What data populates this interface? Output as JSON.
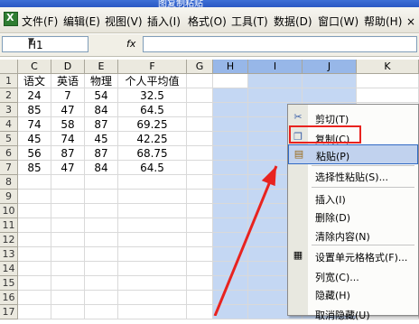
{
  "window": {
    "title_fragment": "图复制粘贴"
  },
  "menubar": {
    "items": [
      "文件(F)",
      "编辑(E)",
      "视图(V)",
      "插入(I)",
      "格式(O)",
      "工具(T)",
      "数据(D)",
      "窗口(W)",
      "帮助(H)"
    ],
    "close_glyph": "×",
    "restore_glyph": "▫"
  },
  "formula_bar": {
    "cell_ref": "H1",
    "fx_label": "fx",
    "content": ""
  },
  "columns": [
    "C",
    "D",
    "E",
    "F",
    "G",
    "H",
    "I",
    "J",
    "K"
  ],
  "rows": [
    "1",
    "2",
    "3",
    "4",
    "5",
    "6",
    "7",
    "8",
    "9",
    "10",
    "11",
    "12",
    "13",
    "14",
    "15",
    "16",
    "17"
  ],
  "table": {
    "headers": [
      "语文",
      "英语",
      "物理",
      "个人平均值"
    ],
    "data": [
      [
        "24",
        "7",
        "54",
        "32.5"
      ],
      [
        "85",
        "47",
        "84",
        "64.5"
      ],
      [
        "74",
        "58",
        "87",
        "69.25"
      ],
      [
        "45",
        "74",
        "45",
        "42.25"
      ],
      [
        "56",
        "87",
        "87",
        "68.75"
      ],
      [
        "85",
        "47",
        "84",
        "64.5"
      ]
    ]
  },
  "context_menu": {
    "items": [
      {
        "label": "剪切(T)",
        "icon": "scissors-icon"
      },
      {
        "label": "复制(C)",
        "icon": "copy-icon"
      },
      {
        "label": "粘贴(P)",
        "icon": "paste-icon"
      },
      {
        "label": "选择性粘贴(S)...",
        "icon": ""
      },
      {
        "label": "插入(I)",
        "icon": ""
      },
      {
        "label": "删除(D)",
        "icon": ""
      },
      {
        "label": "清除内容(N)",
        "icon": ""
      },
      {
        "label": "设置单元格格式(F)...",
        "icon": "format-cells-icon"
      },
      {
        "label": "列宽(C)...",
        "icon": ""
      },
      {
        "label": "隐藏(H)",
        "icon": ""
      },
      {
        "label": "取消隐藏(U)",
        "icon": ""
      }
    ],
    "highlighted": "粘贴(P)",
    "boxed": "复制(C)"
  },
  "colors": {
    "annotation_red": "#e8231f",
    "selection": "#c4d7f3",
    "menu_highlight": "#c1d2ee"
  }
}
